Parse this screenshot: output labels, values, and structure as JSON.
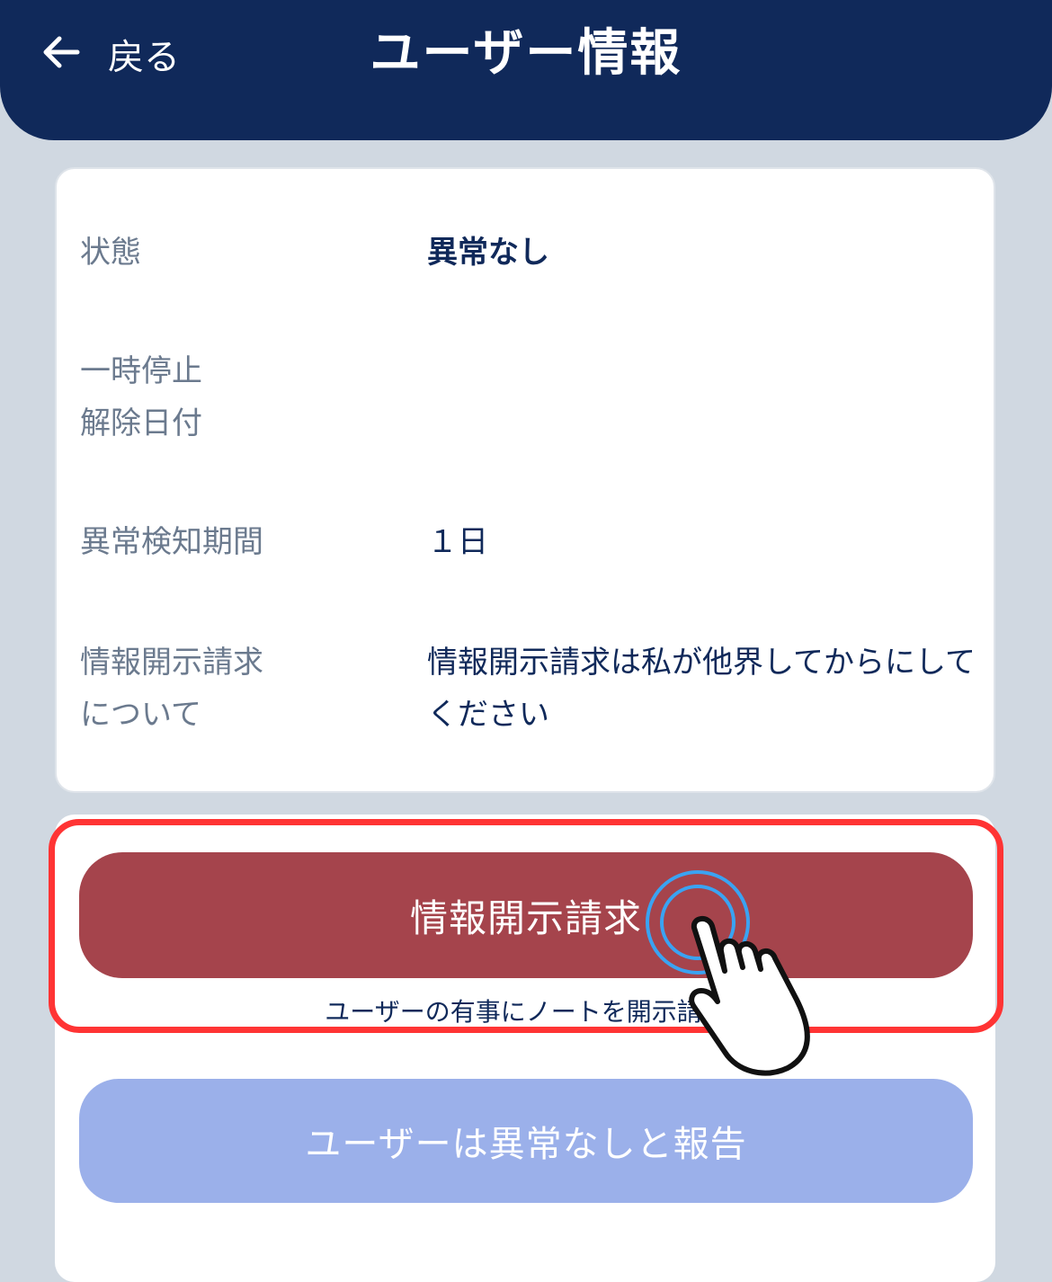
{
  "header": {
    "back_label": "戻る",
    "title": "ユーザー情報"
  },
  "info": {
    "rows": [
      {
        "label": "状態",
        "value": "異常なし"
      },
      {
        "label": "一時停止\n解除日付",
        "value": ""
      },
      {
        "label": "異常検知期間",
        "value": "１日"
      },
      {
        "label": "情報開示請求\nについて",
        "value": "情報開示請求は私が他界してからにしてください"
      }
    ]
  },
  "actions": {
    "disclose_label": "情報開示請求",
    "disclose_caption": "ユーザーの有事にノートを開示請求",
    "report_label": "ユーザーは異常なしと報告"
  },
  "colors": {
    "header_bg": "#10295a",
    "disclose_button": "#a5444c",
    "report_button": "#9bb0ea",
    "highlight": "#ff3434",
    "tap_ring": "#3aa3f2"
  },
  "icons": {
    "back": "arrow-left-icon",
    "tap": "pointing-hand-icon"
  }
}
